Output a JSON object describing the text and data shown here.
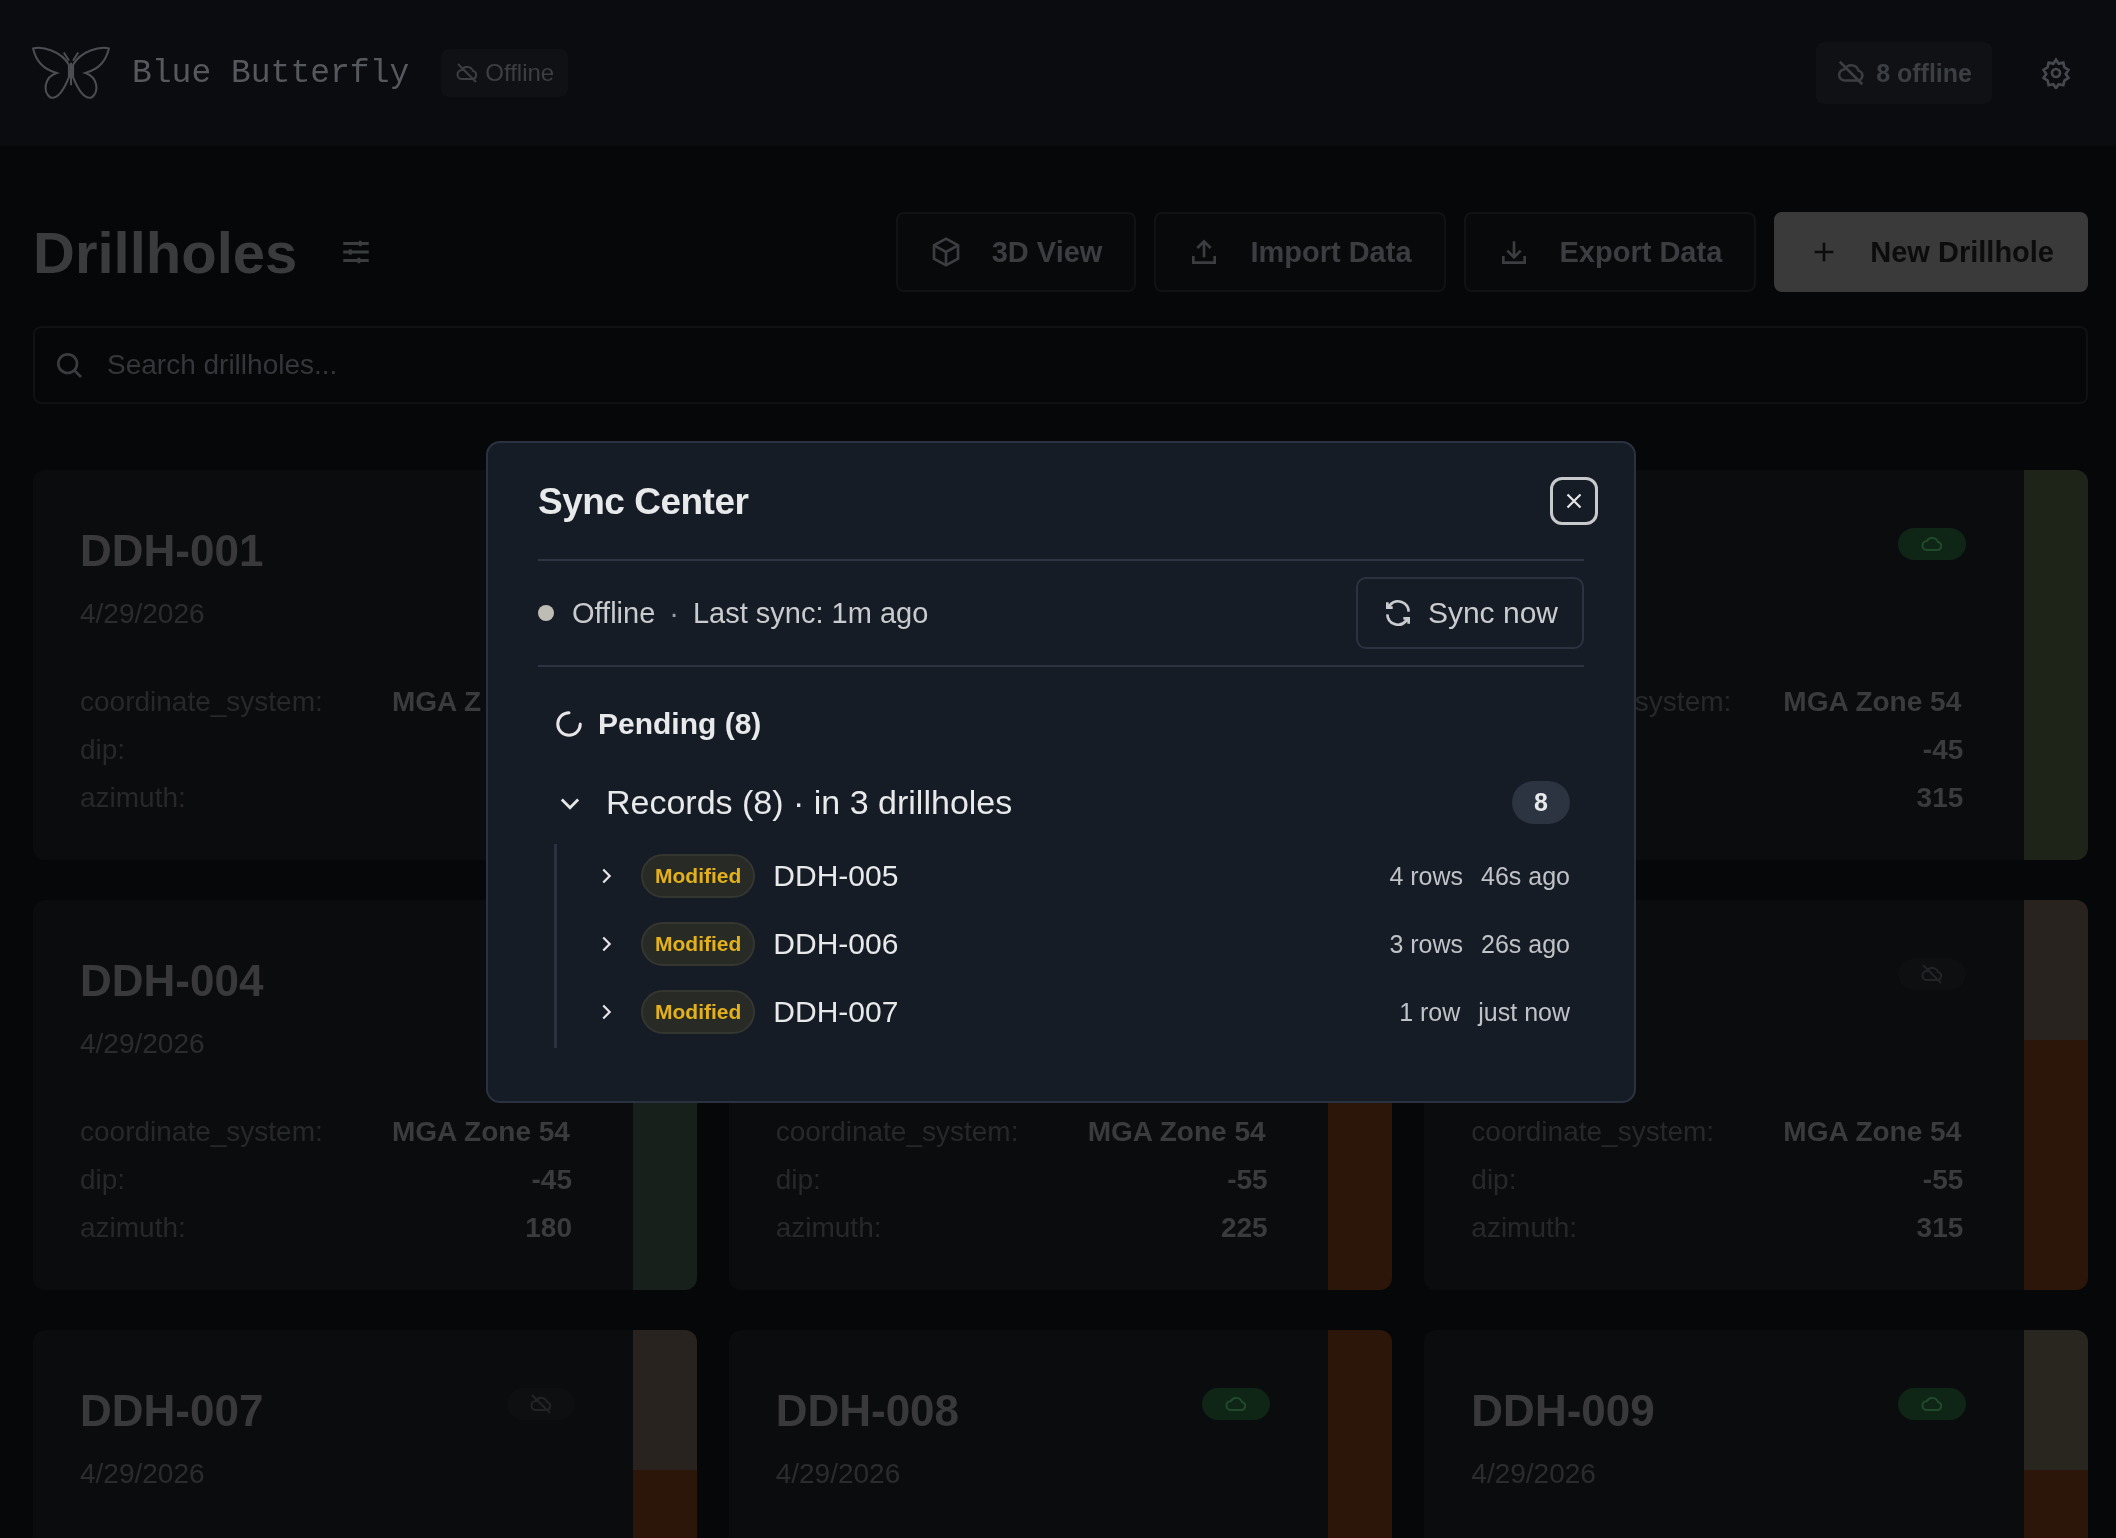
{
  "header": {
    "app_name": "Blue Butterfly",
    "connection": "Offline",
    "offline_count": "8 offline"
  },
  "toolbar": {
    "title": "Drillholes",
    "buttons": [
      {
        "label": "3D View",
        "kind": "cube",
        "primary": false
      },
      {
        "label": "Import Data",
        "kind": "upload",
        "primary": false
      },
      {
        "label": "Export Data",
        "kind": "download",
        "primary": false
      },
      {
        "label": "New Drillhole",
        "kind": "plus",
        "primary": true
      }
    ]
  },
  "search": {
    "placeholder": "Search drillholes..."
  },
  "cards": [
    {
      "title": "DDH-001",
      "date": "4/29/2026",
      "fields": [
        {
          "label": "coordinate_system:",
          "value": "MGA Z",
          "kind": "text"
        },
        {
          "label": "dip:"
        },
        {
          "label": "azimuth:"
        }
      ]
    },
    {
      "clipped": true,
      "synced": true,
      "fields": [
        {
          "label": "system:",
          "value": "MGA Zone 54",
          "kind": "text"
        },
        {
          "value": "-45",
          "kind": "number"
        },
        {
          "value": "315",
          "kind": "number"
        }
      ],
      "strip": [
        {
          "color": "#1f2419"
        }
      ]
    },
    {
      "title": "DDH-004",
      "date": "4/29/2026",
      "fields": [
        {
          "label": "coordinate_system:",
          "value": "MGA Zone 54",
          "kind": "text"
        },
        {
          "label": "dip:",
          "value": "-45",
          "kind": "number"
        },
        {
          "label": "azimuth:",
          "value": "180",
          "kind": "number"
        }
      ],
      "strip": [
        {
          "color": "#17201a"
        }
      ]
    },
    {
      "fields": [
        {
          "label": "coordinate_system:",
          "value": "MGA Zone 54",
          "kind": "text"
        },
        {
          "label": "dip:",
          "value": "-55",
          "kind": "number"
        },
        {
          "label": "azimuth:",
          "value": "225",
          "kind": "number"
        }
      ],
      "strip": [
        {
          "color": "#2b1609"
        }
      ]
    },
    {
      "synced": false,
      "fields": [
        {
          "label": "coordinate_system:",
          "value": "MGA Zone 54",
          "kind": "text"
        },
        {
          "label": "dip:",
          "value": "-55",
          "kind": "number"
        },
        {
          "label": "azimuth:",
          "value": "315",
          "kind": "number"
        }
      ],
      "strip": [
        {
          "color": "#29231f"
        },
        {
          "color": "#2b1609"
        }
      ]
    },
    {
      "title": "DDH-007",
      "date": "4/29/2026",
      "synced": false,
      "strip": [
        {
          "color": "#29231f"
        },
        {
          "color": "#2b1609"
        }
      ]
    },
    {
      "title": "DDH-008",
      "date": "4/29/2026",
      "synced": true,
      "strip": [
        {
          "color": "#2b1609"
        }
      ]
    },
    {
      "title": "DDH-009",
      "date": "4/29/2026",
      "synced": true,
      "strip": [
        {
          "color": "#29261f"
        },
        {
          "color": "#2b1609"
        }
      ]
    }
  ],
  "sync_center": {
    "title": "Sync Center",
    "status": "Offline",
    "separator": "·",
    "last_sync": "Last sync: 1m ago",
    "sync_button": "Sync now",
    "pending": "Pending (8)",
    "group": {
      "label": "Records (8) · in 3 drillholes",
      "count": "8",
      "expanded": true,
      "items": [
        {
          "change": "Modified",
          "name": "DDH-005",
          "rows": "4 rows",
          "time": "46s ago",
          "expanded": false
        },
        {
          "change": "Modified",
          "name": "DDH-006",
          "rows": "3 rows",
          "time": "26s ago",
          "expanded": false
        },
        {
          "change": "Modified",
          "name": "DDH-007",
          "rows": "1 row",
          "time": "just now",
          "expanded": false
        }
      ]
    }
  }
}
